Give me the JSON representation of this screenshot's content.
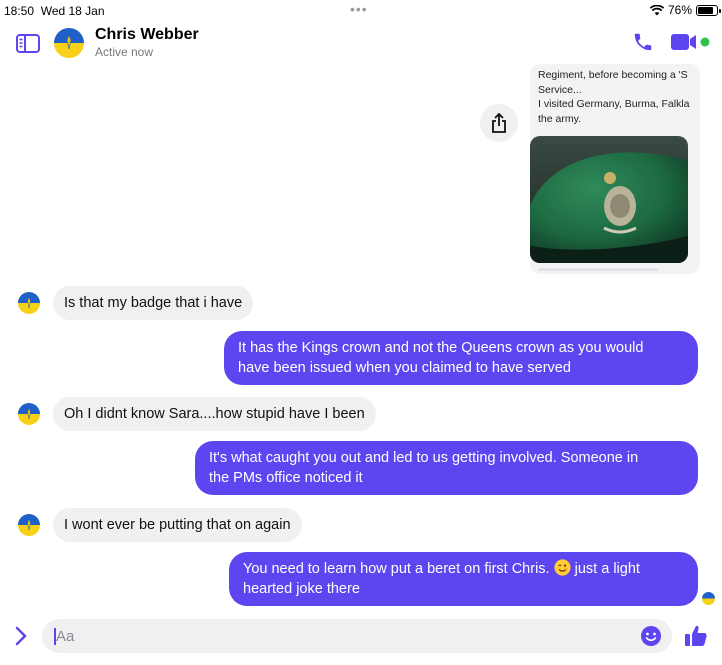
{
  "status_bar": {
    "time": "18:50",
    "date": "Wed 18 Jan",
    "dots": "•••",
    "battery_pct": "76%",
    "battery_level": 0.76
  },
  "header": {
    "contact_name": "Chris Webber",
    "contact_status": "Active now",
    "accent_color": "#5d45f0",
    "online_color": "#31c24d"
  },
  "forwarded_preview": {
    "text_lines": [
      "Regiment, before becoming a 'S",
      "Service...",
      "I visited Germany, Burma, Falkla",
      "the army."
    ],
    "image_label": "beret with badge photo"
  },
  "messages": [
    {
      "direction": "incoming",
      "text": "Is that my badge that i have"
    },
    {
      "direction": "outgoing",
      "lines": [
        "It has the Kings crown and not the Queens crown as you would",
        "have been issued when you claimed to have served"
      ]
    },
    {
      "direction": "incoming",
      "text": "Oh I didnt know Sara....how stupid have I been"
    },
    {
      "direction": "outgoing",
      "lines": [
        "It's what caught you out and led to us getting involved. Someone in",
        "the PMs office noticed it"
      ]
    },
    {
      "direction": "incoming",
      "text": "I wont ever be putting that on again"
    },
    {
      "direction": "outgoing",
      "line1_before": "You need to learn how put a beret on first Chris.",
      "line1_after": "just a light",
      "line2": "hearted joke there",
      "emoji": "winking-face"
    }
  ],
  "composer": {
    "placeholder": "Aa",
    "value": ""
  },
  "icons": {
    "sidebar": "sidebar-icon",
    "call": "phone-icon",
    "video": "video-camera-icon",
    "share": "share-icon",
    "expand": "chevron-right-icon",
    "emoji": "emoji-icon",
    "like": "thumbs-up-icon"
  }
}
